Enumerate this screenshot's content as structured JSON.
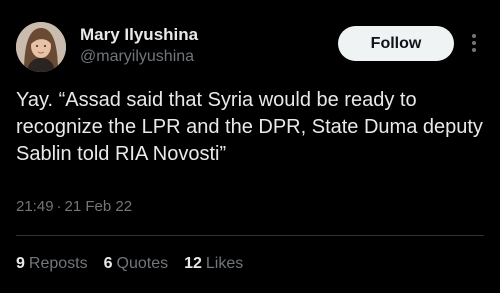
{
  "author": {
    "name": "Mary Ilyushina",
    "handle": "@maryilyushina"
  },
  "follow_label": "Follow",
  "tweet_text": "Yay. “Assad said that Syria would be ready to recognize the LPR and the DPR, State Duma deputy Sablin told RIA Novosti”",
  "time": "21:49",
  "date": "21 Feb 22",
  "date_separator": "·",
  "stats": {
    "reposts_count": "9",
    "reposts_label": "Reposts",
    "quotes_count": "6",
    "quotes_label": "Quotes",
    "likes_count": "12",
    "likes_label": "Likes"
  },
  "icons": {
    "more": "more-vertical-icon",
    "avatar": "profile-photo"
  },
  "colors": {
    "background": "#000000",
    "primary_text": "#e7e9ea",
    "secondary_text": "#71767b",
    "button_bg": "#eff3f4",
    "divider": "#2f3336"
  }
}
